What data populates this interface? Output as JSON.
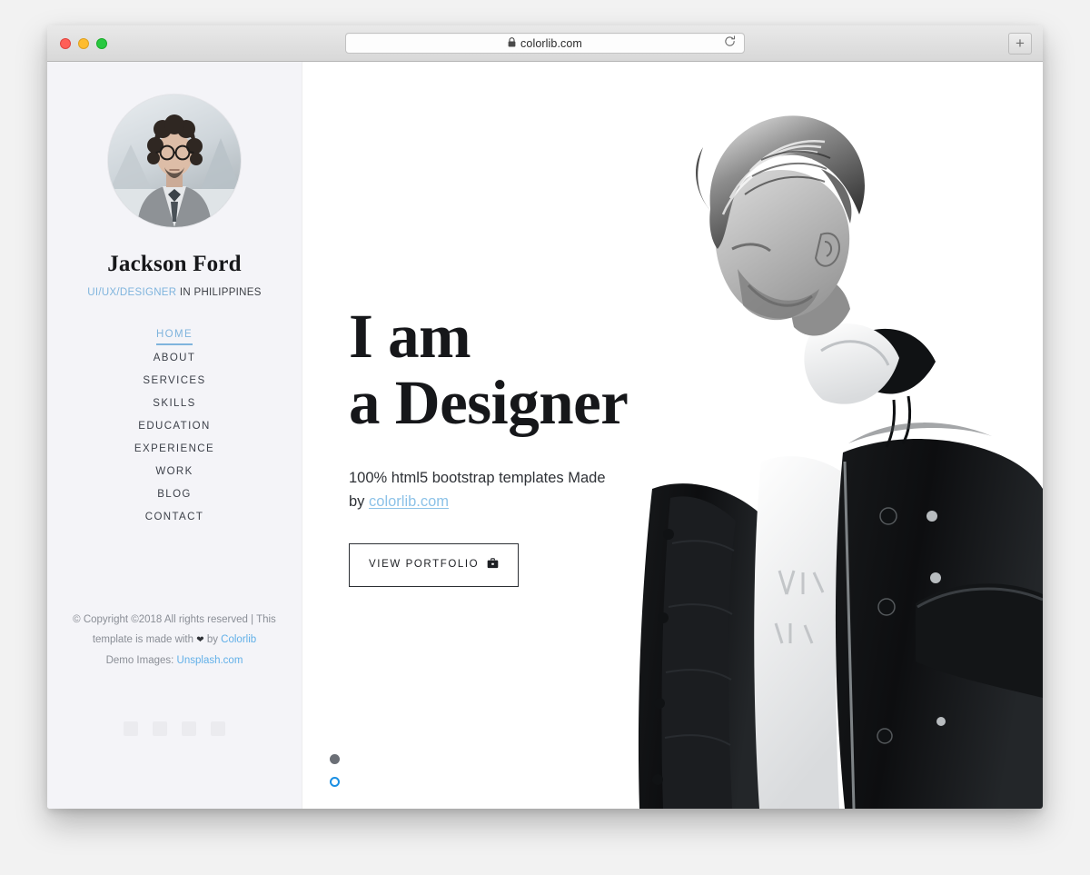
{
  "browser": {
    "url": "colorlib.com",
    "lock_icon": "lock-icon",
    "reload_icon": "reload-icon",
    "new_tab_label": "+",
    "traffic_lights": [
      "close",
      "minimize",
      "maximize"
    ]
  },
  "sidebar": {
    "avatar_alt": "profile-photo",
    "name": "Jackson Ford",
    "tagline_accent": "UI/UX/DESIGNER",
    "tagline_rest": " IN PHILIPPINES",
    "nav": [
      {
        "label": "HOME",
        "active": true
      },
      {
        "label": "ABOUT",
        "active": false
      },
      {
        "label": "SERVICES",
        "active": false
      },
      {
        "label": "SKILLS",
        "active": false
      },
      {
        "label": "EDUCATION",
        "active": false
      },
      {
        "label": "EXPERIENCE",
        "active": false
      },
      {
        "label": "WORK",
        "active": false
      },
      {
        "label": "BLOG",
        "active": false
      },
      {
        "label": "CONTACT",
        "active": false
      }
    ],
    "footer": {
      "line1": "© Copyright ©2018 All rights reserved | This",
      "line2_pre": "template is made with ",
      "line2_heart": "❤",
      "line2_mid": " by ",
      "line2_link": "Colorlib",
      "line3_pre": "Demo Images: ",
      "line3_link": "Unsplash.com"
    }
  },
  "hero": {
    "title_line1": "I am",
    "title_line2": "a Designer",
    "subtitle_pre": "100% html5 bootstrap templates Made by ",
    "subtitle_link": "colorlib.com",
    "button_label": "VIEW PORTFOLIO",
    "button_icon": "briefcase-icon",
    "slider_dots": [
      {
        "state": "filled"
      },
      {
        "state": "ring"
      }
    ],
    "photo_alt": "man-in-black-coat-portrait"
  },
  "colors": {
    "accent_blue": "#7fb4dd",
    "link_blue": "#62b0e8",
    "dot_active": "#1a8fe3",
    "dot_inactive": "#6b6f76",
    "sidebar_bg": "#f4f4f8",
    "text_dark": "#16171a"
  }
}
